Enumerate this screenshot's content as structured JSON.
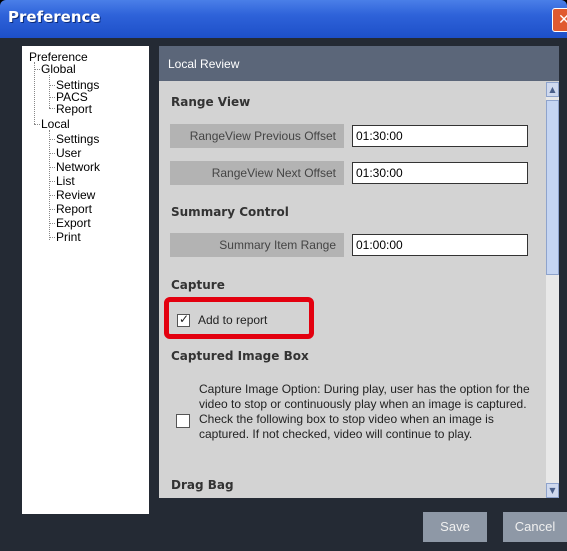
{
  "window": {
    "title": "Preference",
    "close_glyph": "✕"
  },
  "tree": {
    "root": "Preference",
    "groups": [
      {
        "label": "Global",
        "items": [
          "Settings",
          "PACS",
          "Report"
        ]
      },
      {
        "label": "Local",
        "items": [
          "Settings",
          "User",
          "Network",
          "List",
          "Review",
          "Report",
          "Export",
          "Print"
        ]
      }
    ]
  },
  "panel": {
    "title": "Local Review",
    "sections": {
      "range_view": "Range View",
      "summary_control": "Summary Control",
      "capture": "Capture",
      "captured_image_box": "Captured Image Box",
      "drag_bag": "Drag Bag"
    },
    "fields": {
      "range_prev": {
        "label": "RangeView Previous Offset",
        "value": "01:30:00"
      },
      "range_next": {
        "label": "RangeView Next Offset",
        "value": "01:30:00"
      },
      "summary_range": {
        "label": "Summary Item Range",
        "value": "01:00:00"
      }
    },
    "capture": {
      "add_to_report_label": "Add to report",
      "add_to_report_checked": true
    },
    "captured_image_box": {
      "description": "Capture Image Option: During play, user has the option for the video to stop or continuously play when an image is captured. Check the following box to stop video when an image is captured. If not checked, video will continue to play.",
      "checked": false
    }
  },
  "footer": {
    "save_label": "Save",
    "cancel_label": "Cancel"
  },
  "colors": {
    "highlight": "#e3000f",
    "titlebar": "#2e62d9",
    "panel_header": "#5b6679"
  }
}
